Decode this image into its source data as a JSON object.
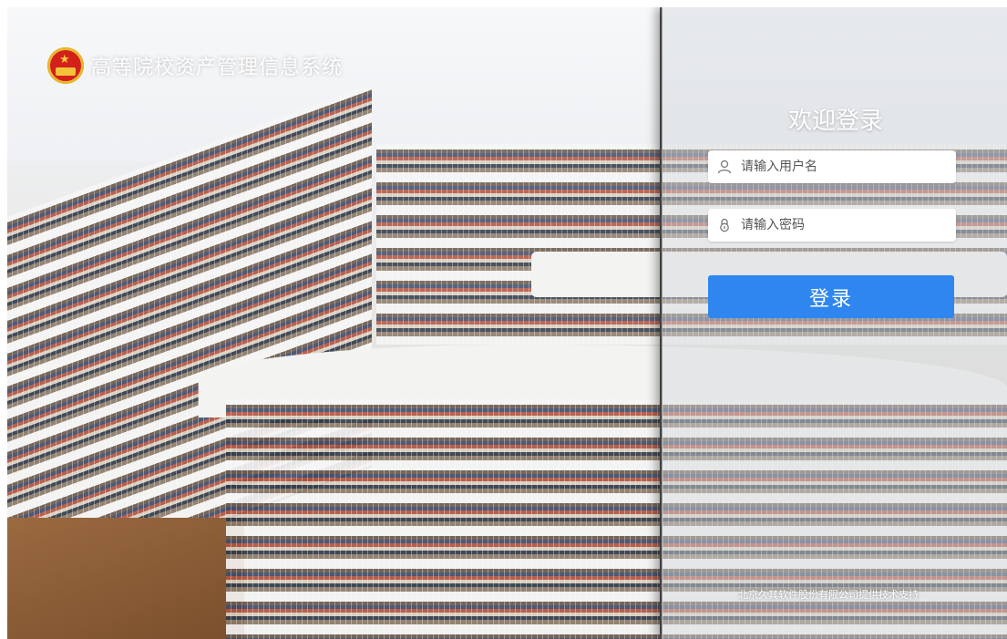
{
  "brand": {
    "title": "高等院校资产管理信息系统",
    "emblem_icon": "national-emblem-icon"
  },
  "login": {
    "heading": "欢迎登录",
    "username_placeholder": "请输入用户名",
    "password_placeholder": "请输入密码",
    "username_icon": "user-icon",
    "password_icon": "lock-icon",
    "submit_label": "登录"
  },
  "footer": {
    "support_text": "北京久其软件股份有限公司提供技术支持"
  },
  "colors": {
    "accent": "#2f86ee",
    "emblem_red": "#d4201a",
    "emblem_gold": "#f3c43a"
  }
}
